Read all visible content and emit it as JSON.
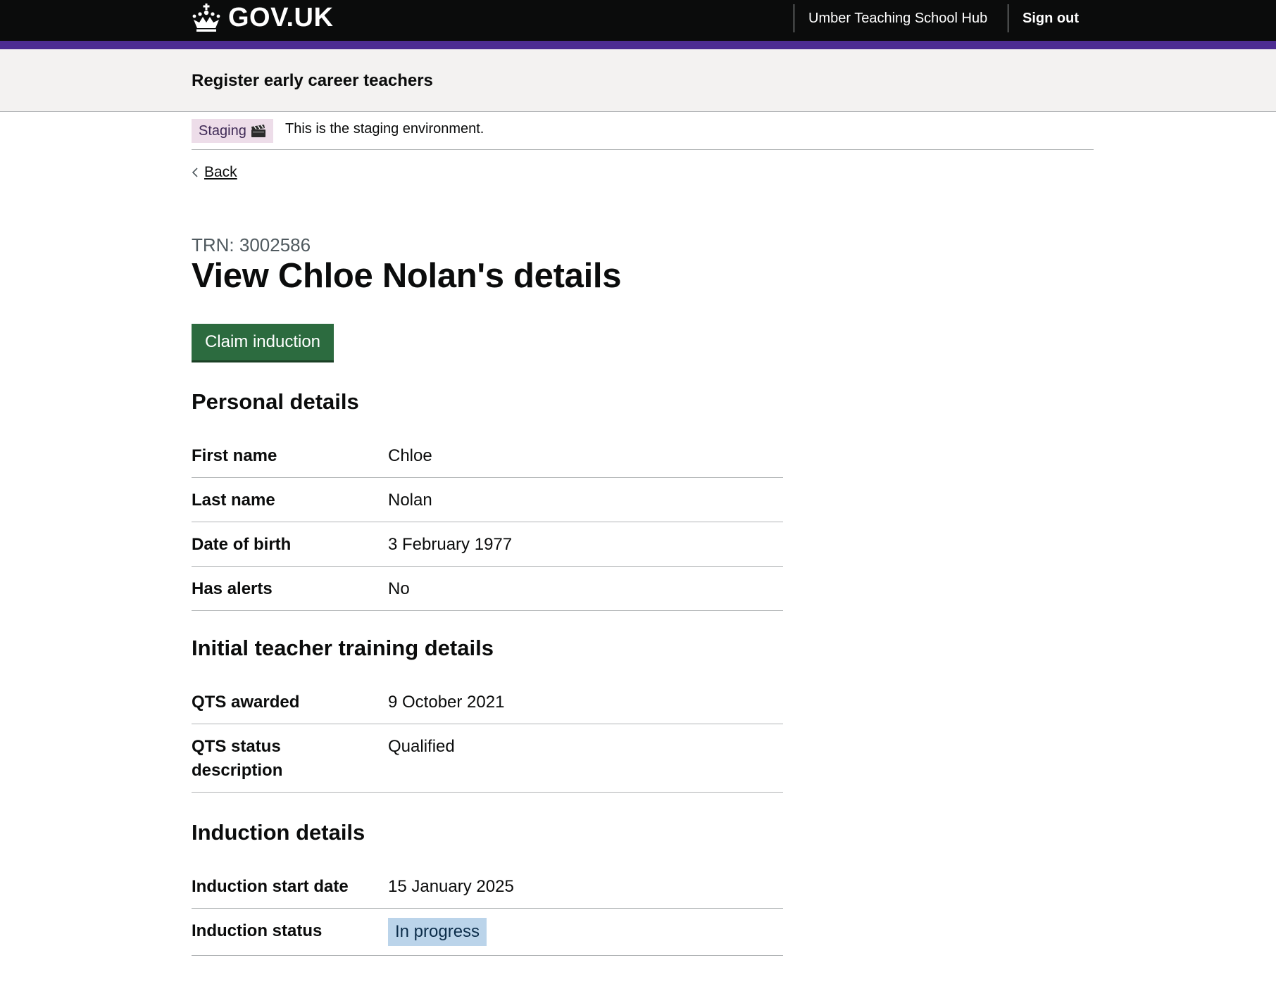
{
  "header": {
    "logo_text": "GOV.UK",
    "org_name": "Umber Teaching School Hub",
    "sign_out_label": "Sign out"
  },
  "service": {
    "name": "Register early career teachers"
  },
  "environment": {
    "tag_label": "Staging",
    "tag_icon": "clapperboard-icon",
    "message": "This is the staging environment."
  },
  "back_link": {
    "label": "Back"
  },
  "page": {
    "caption": "TRN: 3002586",
    "title": "View Chloe Nolan's details",
    "claim_button_label": "Claim induction"
  },
  "sections": {
    "personal": {
      "heading": "Personal details",
      "rows": [
        {
          "key": "First name",
          "value": "Chloe"
        },
        {
          "key": "Last name",
          "value": "Nolan"
        },
        {
          "key": "Date of birth",
          "value": "3 February 1977"
        },
        {
          "key": "Has alerts",
          "value": "No"
        }
      ]
    },
    "itt": {
      "heading": "Initial teacher training details",
      "rows": [
        {
          "key": "QTS awarded",
          "value": "9 October 2021"
        },
        {
          "key": "QTS status description",
          "value": "Qualified"
        }
      ]
    },
    "induction": {
      "heading": "Induction details",
      "rows": [
        {
          "key": "Induction start date",
          "value": "15 January 2025"
        },
        {
          "key": "Induction status",
          "value": "In progress"
        }
      ]
    }
  },
  "colors": {
    "header_bg": "#0b0c0c",
    "brand_stripe": "#4c2c92",
    "button_green": "#2c6b3f",
    "staging_tag_bg": "#eddde9",
    "status_tag_bg": "#bbd4ea"
  }
}
